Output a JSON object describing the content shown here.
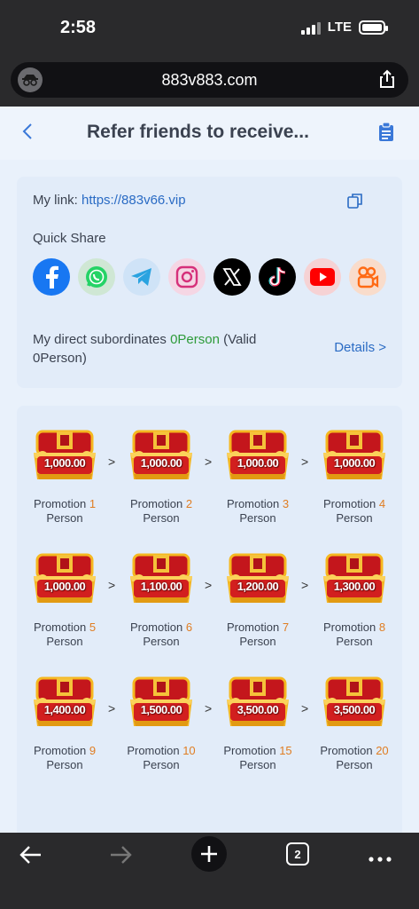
{
  "status_bar": {
    "time": "2:58",
    "network": "LTE"
  },
  "browser": {
    "url": "883v883.com",
    "tab_count": "2"
  },
  "header": {
    "title": "Refer friends to receive..."
  },
  "referral": {
    "my_link_label": "My link:",
    "my_link": "https://883v66.vip",
    "quick_share_label": "Quick Share",
    "share_targets": [
      "facebook",
      "whatsapp",
      "telegram",
      "instagram",
      "x",
      "tiktok",
      "youtube",
      "kwai"
    ],
    "subordinates_prefix": "My direct subordinates",
    "subordinates_count": "0Person",
    "subordinates_valid_prefix": "(Valid",
    "subordinates_valid": "0Person)",
    "details_label": "Details >"
  },
  "promotions": [
    {
      "amount": "1,000.00",
      "label": "Promotion",
      "num": "1",
      "suffix": "Person"
    },
    {
      "amount": "1,000.00",
      "label": "Promotion",
      "num": "2",
      "suffix": "Person"
    },
    {
      "amount": "1,000.00",
      "label": "Promotion",
      "num": "3",
      "suffix": "Person"
    },
    {
      "amount": "1,000.00",
      "label": "Promotion",
      "num": "4",
      "suffix": "Person"
    },
    {
      "amount": "1,000.00",
      "label": "Promotion",
      "num": "5",
      "suffix": "Person"
    },
    {
      "amount": "1,100.00",
      "label": "Promotion",
      "num": "6",
      "suffix": "Person"
    },
    {
      "amount": "1,200.00",
      "label": "Promotion",
      "num": "7",
      "suffix": "Person"
    },
    {
      "amount": "1,300.00",
      "label": "Promotion",
      "num": "8",
      "suffix": "Person"
    },
    {
      "amount": "1,400.00",
      "label": "Promotion",
      "num": "9",
      "suffix": "Person"
    },
    {
      "amount": "1,500.00",
      "label": "Promotion",
      "num": "10",
      "suffix": "Person"
    },
    {
      "amount": "3,500.00",
      "label": "Promotion",
      "num": "15",
      "suffix": "Person"
    },
    {
      "amount": "3,500.00",
      "label": "Promotion",
      "num": "20",
      "suffix": "Person"
    }
  ],
  "colors": {
    "accent": "#2a6bc4",
    "highlight": "#e07d22",
    "green": "#2e9b3a"
  }
}
